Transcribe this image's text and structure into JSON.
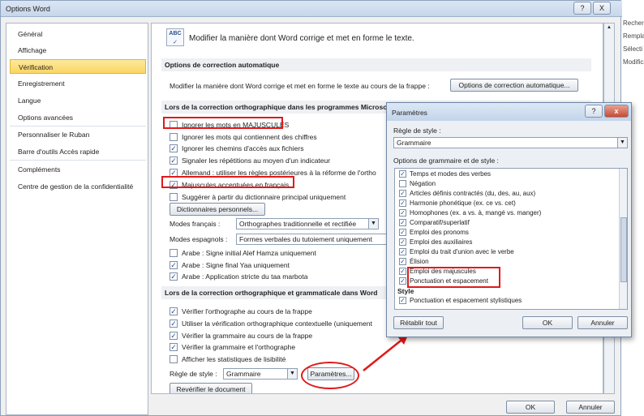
{
  "window": {
    "title": "Options Word",
    "help": "?",
    "close": "X"
  },
  "nav": {
    "items": [
      "Général",
      "Affichage",
      "Vérification",
      "Enregistrement",
      "Langue",
      "Options avancées",
      "Personnaliser le Ruban",
      "Barre d'outils Accès rapide",
      "Compléments",
      "Centre de gestion de la confidentialité"
    ],
    "selected": "Vérification"
  },
  "header": {
    "text": "Modifier la manière dont Word corrige et met en forme le texte.",
    "icon": "abc-check-icon",
    "icon_text": "ABC"
  },
  "autocorrect": {
    "title": "Options de correction automatique",
    "desc": "Modifier la manière dont Word corrige et met en forme le texte au cours de la frappe :",
    "button": "Options de correction automatique..."
  },
  "spelling": {
    "title": "Lors de la correction orthographique dans les programmes Microsoft",
    "items": [
      {
        "label": "Ignorer les mots en MAJUSCULES",
        "checked": false
      },
      {
        "label": "Ignorer les mots qui contiennent des chiffres",
        "checked": false
      },
      {
        "label": "Ignorer les chemins d'accès aux fichiers",
        "checked": true
      },
      {
        "label": "Signaler les répétitions au moyen d'un indicateur",
        "checked": true
      },
      {
        "label": "Allemand : utiliser les règles postérieures à la réforme de l'ortho",
        "checked": true
      },
      {
        "label": "Majuscules accentuées en français",
        "checked": true
      },
      {
        "label": "Suggérer à partir du dictionnaire principal uniquement",
        "checked": false
      }
    ],
    "dict_button": "Dictionnaires personnels...",
    "french_label": "Modes français :",
    "french_value": "Orthographes traditionnelle et rectifiée",
    "spanish_label": "Modes espagnols :",
    "spanish_value": "Formes verbales du tutoiement uniquement",
    "arabic": [
      {
        "label": "Arabe : Signe initial Alef Hamza uniquement",
        "checked": false
      },
      {
        "label": "Arabe : Signe final Yaa uniquement",
        "checked": true
      },
      {
        "label": "Arabe : Application stricte du taa marbota",
        "checked": true
      }
    ]
  },
  "grammar": {
    "title": "Lors de la correction orthographique et grammaticale dans Word",
    "items": [
      {
        "label": "Vérifier l'orthographe au cours de la frappe",
        "checked": true
      },
      {
        "label": "Utiliser la vérification orthographique contextuelle (uniquement",
        "checked": true
      },
      {
        "label": "Vérifier la grammaire au cours de la frappe",
        "checked": true
      },
      {
        "label": "Vérifier la grammaire et l'orthographe",
        "checked": true
      },
      {
        "label": "Afficher les statistiques de lisibilité",
        "checked": false
      }
    ],
    "style_label": "Règle de style :",
    "style_value": "Grammaire",
    "params_button": "Paramètres...",
    "recheck_button": "Revérifier le document"
  },
  "footer": {
    "ok": "OK",
    "cancel": "Annuler"
  },
  "side": {
    "items": [
      "Recher",
      "Rempla",
      "Sélecti",
      "Modifica"
    ]
  },
  "dialog": {
    "title": "Paramètres",
    "help": "?",
    "close": "x",
    "style_label": "Règle de style :",
    "style_value": "Grammaire",
    "options_label": "Options de grammaire et de style :",
    "items": [
      {
        "label": "Temps et modes des verbes",
        "checked": true
      },
      {
        "label": "Négation",
        "checked": false
      },
      {
        "label": "Articles définis contractés (du, des, au, aux)",
        "checked": true
      },
      {
        "label": "Harmonie phonétique (ex. ce vs. cet)",
        "checked": true
      },
      {
        "label": "Homophones (ex. a vs. à, mangé vs. manger)",
        "checked": true
      },
      {
        "label": "Comparatif/superlatif",
        "checked": true
      },
      {
        "label": "Emploi des pronoms",
        "checked": true
      },
      {
        "label": "Emploi des auxiliaires",
        "checked": true
      },
      {
        "label": "Emploi du trait d'union avec le verbe",
        "checked": true
      },
      {
        "label": "Élision",
        "checked": true
      },
      {
        "label": "Emploi des majuscules",
        "checked": true
      },
      {
        "label": "Ponctuation et espacement",
        "checked": true
      }
    ],
    "style_heading": "Style",
    "style_items": [
      {
        "label": "Ponctuation et espacement stylistiques",
        "checked": true
      }
    ],
    "reset": "Rétablir tout",
    "ok": "OK",
    "cancel": "Annuler"
  },
  "colors": {
    "highlight": "#e01a1a",
    "selected_nav": "#fbd563"
  }
}
